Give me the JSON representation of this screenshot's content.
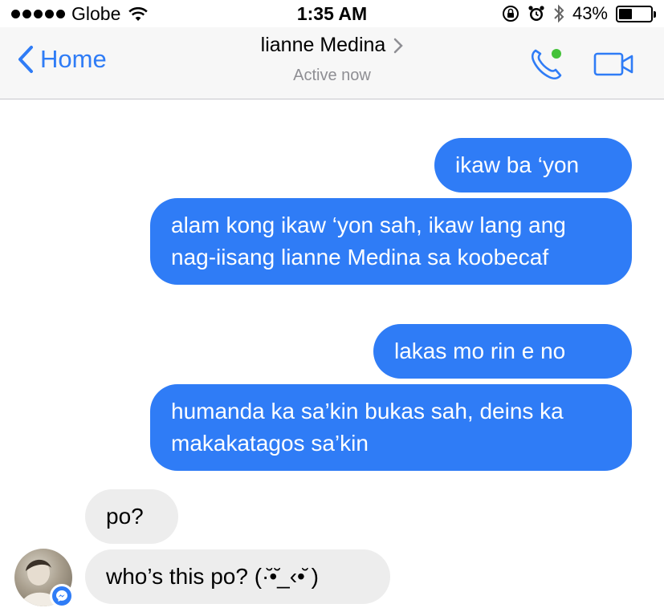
{
  "status_bar": {
    "carrier": "Globe",
    "time": "1:35 AM",
    "battery_percent": "43%",
    "battery_level": 0.43,
    "icons": [
      "signal-dots-icon",
      "wifi-icon",
      "orientation-lock-icon",
      "alarm-icon",
      "bluetooth-icon",
      "battery-icon"
    ]
  },
  "nav": {
    "back_label": "Home",
    "contact_name": "lianne Medina",
    "presence": "Active now",
    "accent": "#2f7cf6",
    "active_dot": "#44c23a",
    "icons": [
      "chevron-left-icon",
      "chevron-right-icon",
      "phone-icon",
      "video-camera-icon"
    ]
  },
  "messages": [
    {
      "direction": "outgoing",
      "text": "ikaw ba ‘yon"
    },
    {
      "direction": "outgoing",
      "text": "alam kong ikaw ‘yon sah, ikaw lang ang nag-iisang lianne Medina sa koobecaf"
    },
    {
      "direction": "outgoing",
      "text": "lakas mo rin e no"
    },
    {
      "direction": "outgoing",
      "text": "humanda ka sa’kin bukas sah, deins ka makakatagos sa’kin"
    },
    {
      "direction": "incoming",
      "text": "po?"
    },
    {
      "direction": "incoming",
      "text": "who’s this po? (·̆•̆_‹•̆ )"
    }
  ],
  "colors": {
    "outgoing_bubble": "#2f7cf6",
    "incoming_bubble": "#ededed"
  }
}
